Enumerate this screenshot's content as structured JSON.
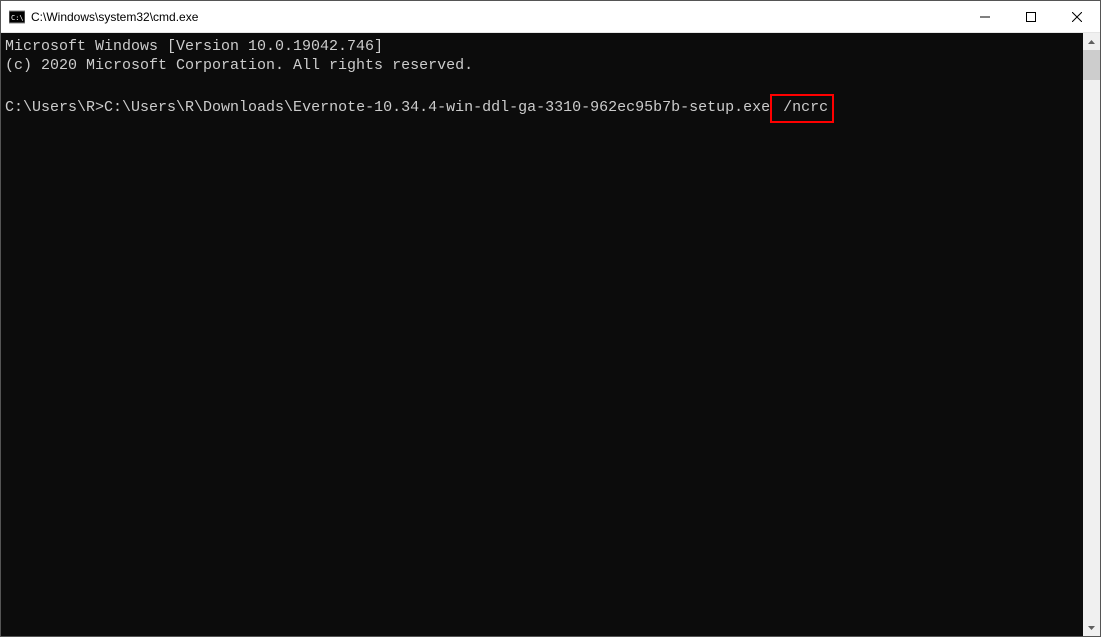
{
  "titlebar": {
    "title": "C:\\Windows\\system32\\cmd.exe"
  },
  "console": {
    "line1": "Microsoft Windows [Version 10.0.19042.746]",
    "line2": "(c) 2020 Microsoft Corporation. All rights reserved.",
    "blank": "",
    "prompt": "C:\\Users\\R>",
    "command": "C:\\Users\\R\\Downloads\\Evernote-10.34.4-win-ddl-ga-3310-962ec95b7b-setup.exe",
    "flag_space": " ",
    "flag": "/ncrc"
  }
}
